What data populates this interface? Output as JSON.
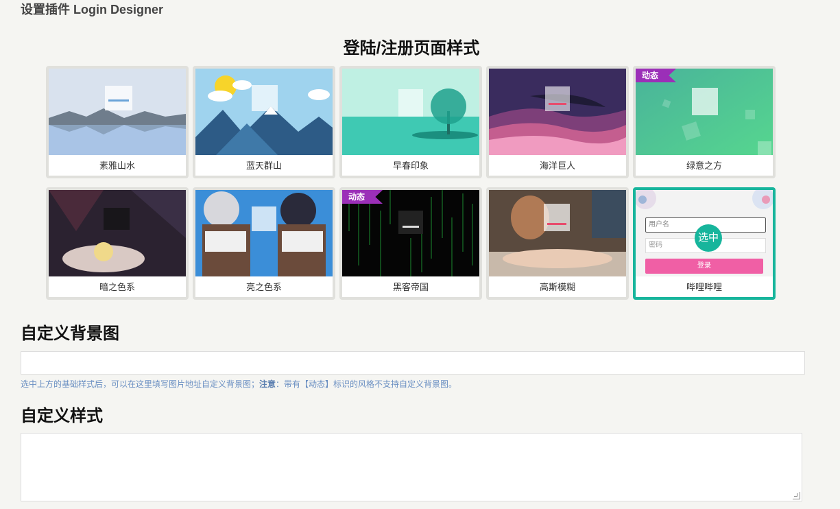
{
  "header": {
    "title": "设置插件 Login Designer"
  },
  "styles_section": {
    "title": "登陆/注册页面样式"
  },
  "cards": [
    {
      "label": "素雅山水",
      "badge": ""
    },
    {
      "label": "蓝天群山",
      "badge": ""
    },
    {
      "label": "早春印象",
      "badge": ""
    },
    {
      "label": "海洋巨人",
      "badge": ""
    },
    {
      "label": "绿意之方",
      "badge": "动态"
    },
    {
      "label": "暗之色系",
      "badge": ""
    },
    {
      "label": "亮之色系",
      "badge": ""
    },
    {
      "label": "黑客帝国",
      "badge": "动态"
    },
    {
      "label": "高斯模糊",
      "badge": ""
    },
    {
      "label": "哔哩哔哩",
      "badge": "",
      "selected": true
    }
  ],
  "selected_marker": "选中",
  "bilibili_preview": {
    "username_placeholder": "用户名",
    "password_placeholder": "密码",
    "login_button": "登录"
  },
  "custom_bg": {
    "title": "自定义背景图",
    "value": "",
    "hint_before": "选中上方的基础样式后，可以在这里填写图片地址自定义背景图；",
    "hint_note": "注意",
    "hint_after": "：带有【动态】标识的风格不支持自定义背景图。"
  },
  "custom_style": {
    "title": "自定义样式",
    "value": ""
  },
  "colors": {
    "accent": "#17b59c",
    "badge": "#9b2fb8",
    "hint": "#6a8fc2"
  }
}
